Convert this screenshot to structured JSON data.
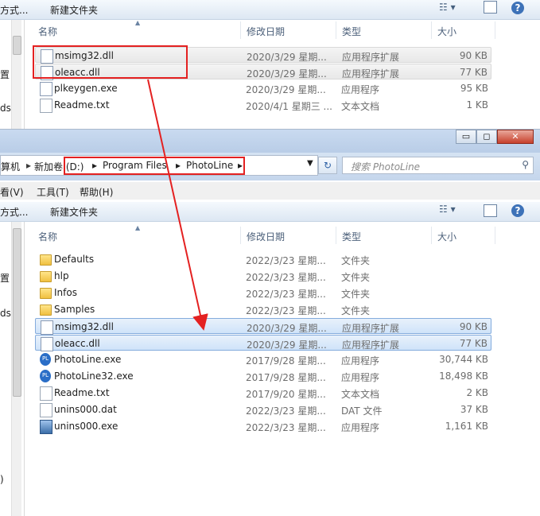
{
  "top": {
    "toolbar": {
      "open_with": "方式...",
      "new_folder": "新建文件夹"
    },
    "columns": {
      "name": "名称",
      "date": "修改日期",
      "type": "类型",
      "size": "大小"
    },
    "left_glyphs": [
      "置",
      "ds"
    ],
    "files": [
      {
        "name": "msimg32.dll",
        "date": "2020/3/29 星期...",
        "type": "应用程序扩展",
        "size": "90 KB",
        "icon": "dll-file-icon"
      },
      {
        "name": "oleacc.dll",
        "date": "2020/3/29 星期...",
        "type": "应用程序扩展",
        "size": "77 KB",
        "icon": "dll-file-icon"
      },
      {
        "name": "plkeygen.exe",
        "date": "2020/3/29 星期...",
        "type": "应用程序",
        "size": "95 KB",
        "icon": "exe-file-icon"
      },
      {
        "name": "Readme.txt",
        "date": "2020/4/1 星期三 ...",
        "type": "文本文档",
        "size": "1 KB",
        "icon": "text-file-icon"
      }
    ]
  },
  "bottom": {
    "window_buttons": {
      "minimize": "▭",
      "maximize": "◻",
      "close": "✕"
    },
    "address": {
      "prefix": "算机",
      "crumbs": [
        "新加卷 (D:)",
        "Program Files",
        "PhotoLine"
      ],
      "separator": "▸"
    },
    "search_placeholder": "搜索 PhotoLine",
    "menu": {
      "view": "看(V)",
      "tools": "工具(T)",
      "help": "帮助(H)"
    },
    "toolbar": {
      "open_with": "方式...",
      "new_folder": "新建文件夹"
    },
    "columns": {
      "name": "名称",
      "date": "修改日期",
      "type": "类型",
      "size": "大小"
    },
    "left_glyphs": [
      "置",
      "ds",
      ")"
    ],
    "files": [
      {
        "name": "Defaults",
        "date": "2022/3/23 星期...",
        "type": "文件夹",
        "size": "",
        "icon": "folder-icon"
      },
      {
        "name": "hlp",
        "date": "2022/3/23 星期...",
        "type": "文件夹",
        "size": "",
        "icon": "folder-icon"
      },
      {
        "name": "Infos",
        "date": "2022/3/23 星期...",
        "type": "文件夹",
        "size": "",
        "icon": "folder-icon"
      },
      {
        "name": "Samples",
        "date": "2022/3/23 星期...",
        "type": "文件夹",
        "size": "",
        "icon": "folder-icon"
      },
      {
        "name": "msimg32.dll",
        "date": "2020/3/29 星期...",
        "type": "应用程序扩展",
        "size": "90 KB",
        "icon": "dll-file-icon"
      },
      {
        "name": "oleacc.dll",
        "date": "2020/3/29 星期...",
        "type": "应用程序扩展",
        "size": "77 KB",
        "icon": "dll-file-icon"
      },
      {
        "name": "PhotoLine.exe",
        "date": "2017/9/28 星期...",
        "type": "应用程序",
        "size": "30,744 KB",
        "icon": "photoline-app-icon"
      },
      {
        "name": "PhotoLine32.exe",
        "date": "2017/9/28 星期...",
        "type": "应用程序",
        "size": "18,498 KB",
        "icon": "photoline-app-icon"
      },
      {
        "name": "Readme.txt",
        "date": "2017/9/20 星期...",
        "type": "文本文档",
        "size": "2 KB",
        "icon": "text-file-icon"
      },
      {
        "name": "unins000.dat",
        "date": "2022/3/23 星期...",
        "type": "DAT 文件",
        "size": "37 KB",
        "icon": "dat-file-icon"
      },
      {
        "name": "unins000.exe",
        "date": "2022/3/23 星期...",
        "type": "应用程序",
        "size": "1,161 KB",
        "icon": "setup-exe-icon"
      }
    ]
  },
  "colors": {
    "annotation_red": "#e42121",
    "selection_blue": "#cfe3f9",
    "chrome_blue": "#dde7f3"
  }
}
